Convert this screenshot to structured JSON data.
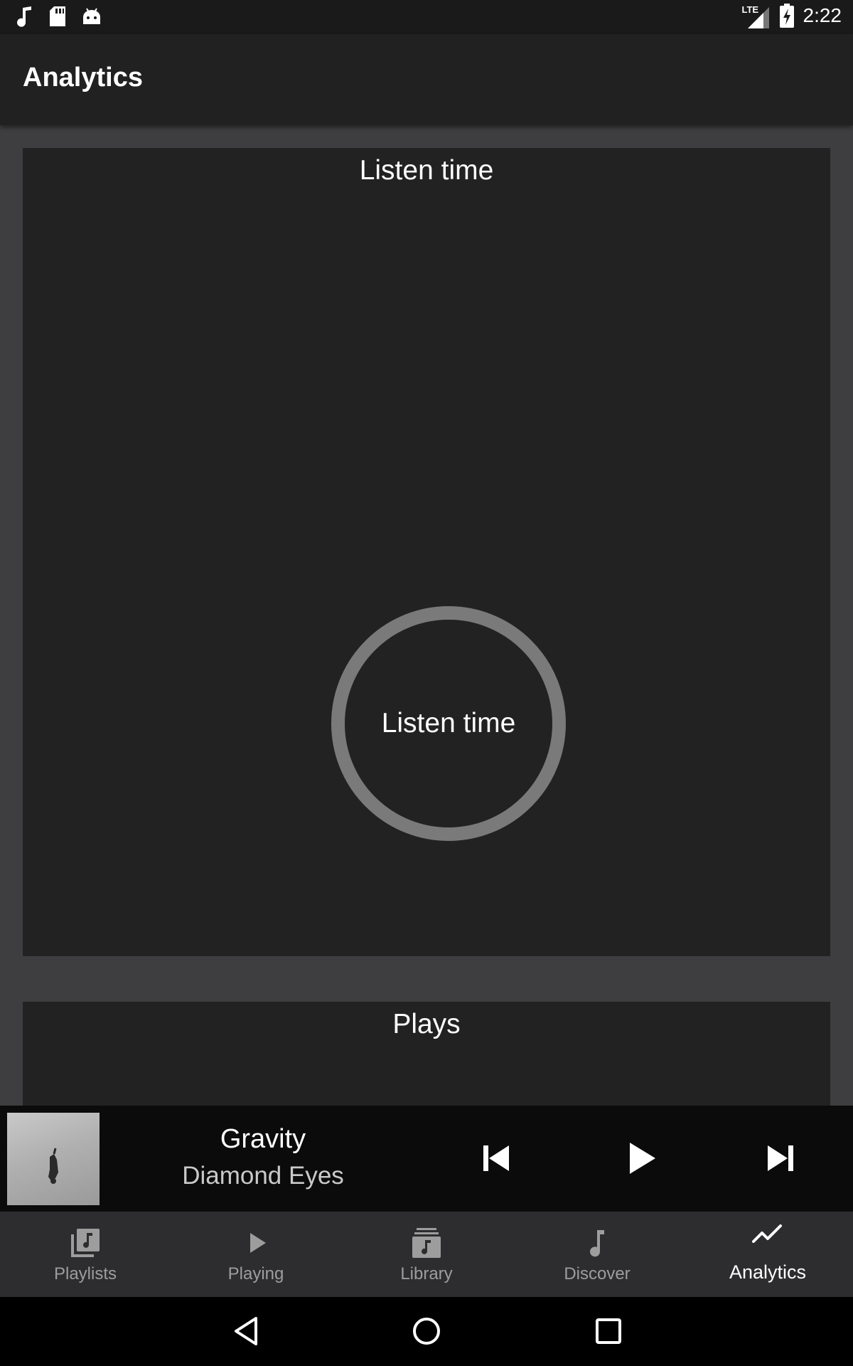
{
  "status_bar": {
    "time": "2:22",
    "network": "LTE",
    "left_icons": [
      "music-note-icon",
      "sd-card-icon",
      "android-icon"
    ]
  },
  "app_bar": {
    "title": "Analytics"
  },
  "cards": {
    "listen_time": {
      "title": "Listen time",
      "center_label": "Listen time"
    },
    "plays": {
      "title": "Plays"
    }
  },
  "now_playing": {
    "title": "Gravity",
    "artist": "Diamond Eyes"
  },
  "bottom_nav": {
    "items": [
      {
        "label": "Playlists",
        "icon": "playlists-icon",
        "active": false
      },
      {
        "label": "Playing",
        "icon": "play-arrow-icon",
        "active": false
      },
      {
        "label": "Library",
        "icon": "library-icon",
        "active": false
      },
      {
        "label": "Discover",
        "icon": "music-note-icon",
        "active": false
      },
      {
        "label": "Analytics",
        "icon": "trending-icon",
        "active": true
      }
    ]
  },
  "colors": {
    "app_bar": "#212121",
    "page_background": "#3e3e40",
    "card": "#222222",
    "ring": "#7a7a7a",
    "nav_inactive": "#9d9d9d",
    "nav_active": "#ffffff"
  }
}
